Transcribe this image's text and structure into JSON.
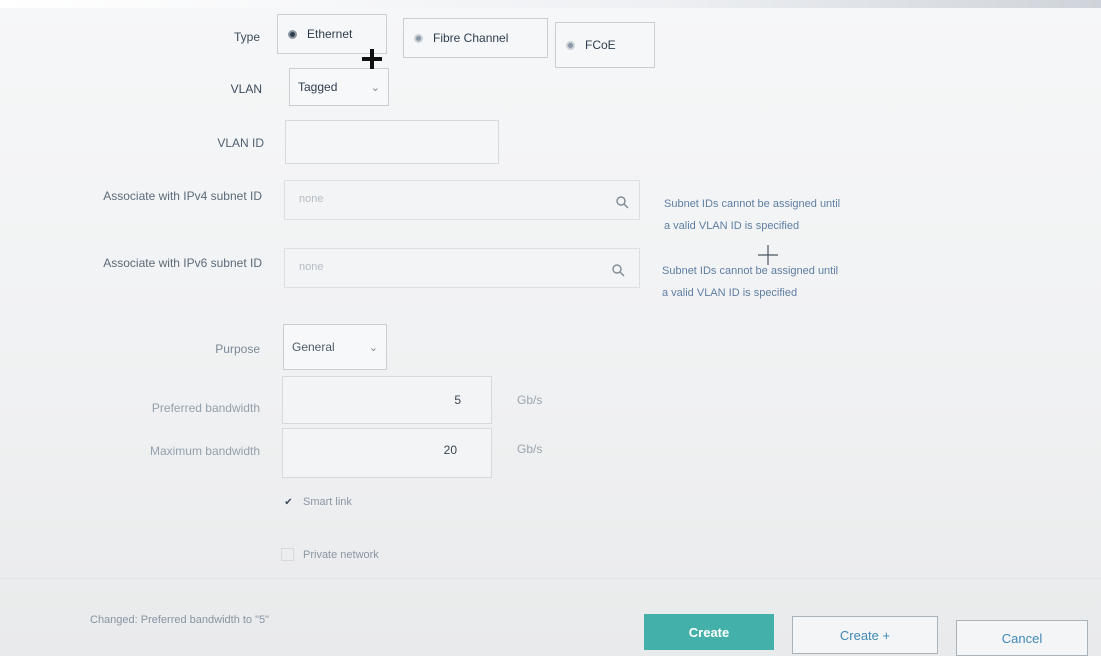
{
  "form": {
    "type": {
      "label": "Type",
      "options": [
        {
          "label": "Ethernet",
          "selected": true
        },
        {
          "label": "Fibre Channel",
          "selected": false
        },
        {
          "label": "FCoE",
          "selected": false
        }
      ]
    },
    "vlan": {
      "label": "VLAN",
      "value": "Tagged"
    },
    "vlan_id": {
      "label": "VLAN ID",
      "value": ""
    },
    "ipv4_subnet": {
      "label": "Associate with IPv4 subnet ID",
      "placeholder": "none",
      "hint_line1": "Subnet IDs cannot be assigned until",
      "hint_line2": "a valid VLAN ID is specified"
    },
    "ipv6_subnet": {
      "label": "Associate with IPv6 subnet ID",
      "placeholder": "none",
      "hint_line1": "Subnet IDs cannot be assigned until",
      "hint_line2": "a valid VLAN ID is specified"
    },
    "purpose": {
      "label": "Purpose",
      "value": "General"
    },
    "preferred_bandwidth": {
      "label": "Preferred bandwidth",
      "value": "5",
      "unit": "Gb/s"
    },
    "maximum_bandwidth": {
      "label": "Maximum bandwidth",
      "value": "20",
      "unit": "Gb/s"
    },
    "smart_link": {
      "label": "Smart link",
      "checked": true
    },
    "private_network": {
      "label": "Private network",
      "checked": false
    }
  },
  "footer": {
    "status": "Changed: Preferred bandwidth to \"5\"",
    "create_label": "Create",
    "create_plus_label": "Create +",
    "cancel_label": "Cancel"
  },
  "colors": {
    "primary_button": "#43b1a9",
    "link_text": "#3f88b6",
    "hint_text": "#5e7ea3"
  },
  "icons": {
    "search": "search-icon",
    "cursor": "crosshair-cursor-icon"
  }
}
